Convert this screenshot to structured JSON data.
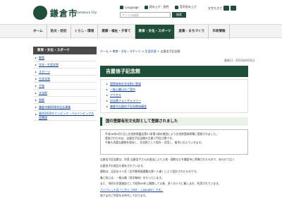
{
  "header": {
    "site_title": "鎌倉市",
    "site_sub": "Kamakura City",
    "language": "Language",
    "reading": "読み上げ・配色",
    "sitemap": "音声読み上げ",
    "search_placeholder": "サイト内検索",
    "search_button": "検索",
    "font_size_label": "文字大きさ"
  },
  "nav": [
    "ホーム",
    "防災・防犯",
    "くらし・環境",
    "健康・福祉・子育て",
    "教育・文化・スポーツ",
    "産業・まちづくり",
    "市政情報"
  ],
  "nav_active_index": 4,
  "sidebar": {
    "heading": "教育・文化・スポーツ",
    "items": [
      "教育",
      "文化・生涯学習",
      "スポーツ",
      "生涯学習",
      "平和",
      "文化財",
      "国際",
      "鎌倉市制80周年記念事業",
      "東京2020オリンピック・パラリンピック大会関連"
    ]
  },
  "breadcrumb": {
    "items": [
      "ホーム",
      "教育・文化・スポーツ",
      "生涯学習",
      "吉屋信子記念館"
    ]
  },
  "updated": "更新日：2023年9月6日",
  "page_title": "吉屋信子記念館",
  "toc": [
    "国登録有形文化財に登録",
    "一般公開日のご案内",
    "アクセス",
    "記念館フォトギャラリー",
    "鎌倉市吉屋信子記念館協議会"
  ],
  "section_heading": "国の登録有形文化財として登録されました",
  "notice_lines": [
    "平成28年8月1日に文化財保護法第57条第1項の規定により文化財登録原簿に登録されました。",
    "登録されたのは、吉屋信子記念館の主屋と門及び塀です。",
    "今後も貴重な建物を保存し、文化財として保存・活用し、後世に伝えていきます。"
  ],
  "body_lines": [
    "吉屋信子記念館は、作家 吉屋信子さんの遺志により土地・建物などを鎌倉市に寄贈されたもので、あわせて広く",
    "吉屋信子の遺品も保存されています。",
    "建物は、吉田五十八氏（近代数寄屋建築の第一人者）により設計されたものです。",
    "春と秋には、一般公開（見学無料）を行っています。",
    "また、市民の学習施設として昭和49年に開館して以来、多くの人々に親しまれ、利用されています。",
    "パンフレットは（こちら（PDF：1,892KB））です。",
    "皆さまのご利用をお待ちしております。"
  ]
}
